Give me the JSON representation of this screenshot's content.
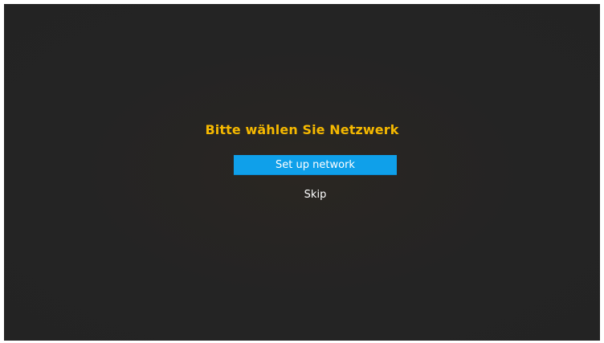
{
  "dialog": {
    "title": "Bitte wählen Sie Netzwerk",
    "options": [
      {
        "label": "Set up network",
        "selected": true
      },
      {
        "label": "Skip",
        "selected": false
      }
    ]
  },
  "colors": {
    "background": "#242424",
    "title": "#f5b800",
    "highlight": "#0fa0ea",
    "text": "#ffffff"
  }
}
